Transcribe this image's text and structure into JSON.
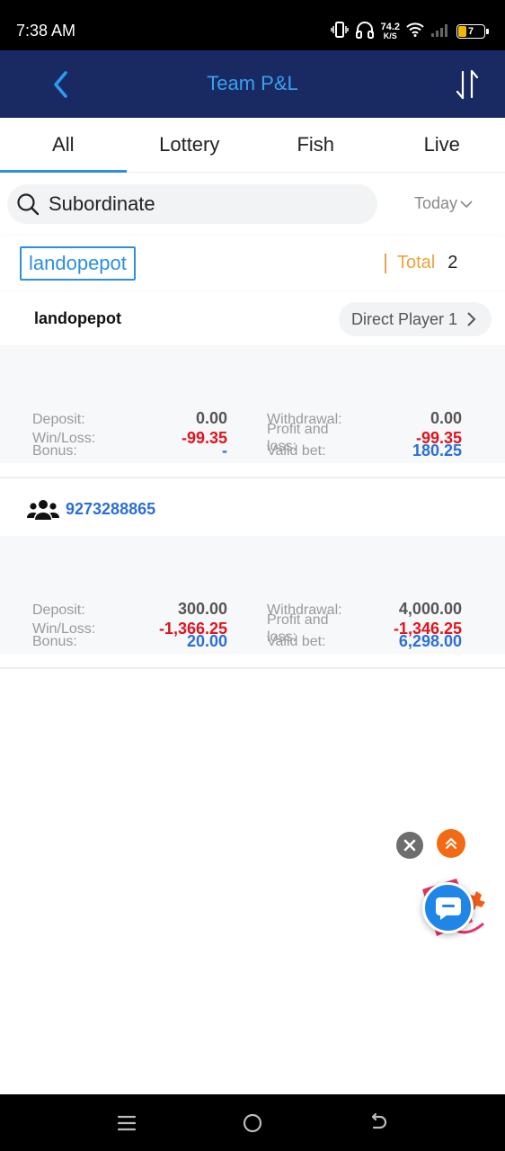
{
  "status_bar": {
    "time": "7:38 AM",
    "net_speed_value": "74.2",
    "net_speed_unit": "K/S",
    "battery": "7",
    "icons": [
      "vibrate-icon",
      "headset-icon",
      "wifi-icon",
      "signal-icon",
      "battery-icon"
    ]
  },
  "header": {
    "title": "Team P&L",
    "back_icon": "back-arrow-icon",
    "sort_icon": "sort-icon",
    "accent_color": "#3aa0f0",
    "background_color": "#192a63"
  },
  "tabs": [
    {
      "label": "All",
      "active": true
    },
    {
      "label": "Lottery",
      "active": false
    },
    {
      "label": "Fish",
      "active": false
    },
    {
      "label": "Live",
      "active": false
    }
  ],
  "search": {
    "value": "Subordinate",
    "icon": "search-icon"
  },
  "date_filter": {
    "selected": "Today"
  },
  "summary": {
    "user": "landopepot",
    "total_label": "Total",
    "total_value": "2"
  },
  "cards": [
    {
      "name": "landopepot",
      "direct_label": "Direct Player 1",
      "deposit_label": "Deposit:",
      "deposit": "0.00",
      "withdrawal_label": "Withdrawal:",
      "withdrawal": "0.00",
      "bonus_label": "Bonus:",
      "bonus": "-",
      "valid_bet_label": "Valid bet:",
      "valid_bet": "180.25",
      "winloss_label": "Win/Loss:",
      "winloss": "-99.35",
      "profit_label": "Profit and loss:",
      "profit": "-99.35"
    },
    {
      "name": "9273288865",
      "icon": "team-icon",
      "deposit_label": "Deposit:",
      "deposit": "300.00",
      "withdrawal_label": "Withdrawal:",
      "withdrawal": "4,000.00",
      "bonus_label": "Bonus:",
      "bonus": "20.00",
      "valid_bet_label": "Valid bet:",
      "valid_bet": "6,298.00",
      "winloss_label": "Win/Loss:",
      "winloss": "-1,366.25",
      "profit_label": "Profit and loss:",
      "profit": "-1,346.25"
    }
  ],
  "colors": {
    "positive_blue": "#2b6fd6",
    "negative_red": "#e0141d",
    "tab_underline": "#2b8fde",
    "total_orange": "#f0a13a"
  }
}
